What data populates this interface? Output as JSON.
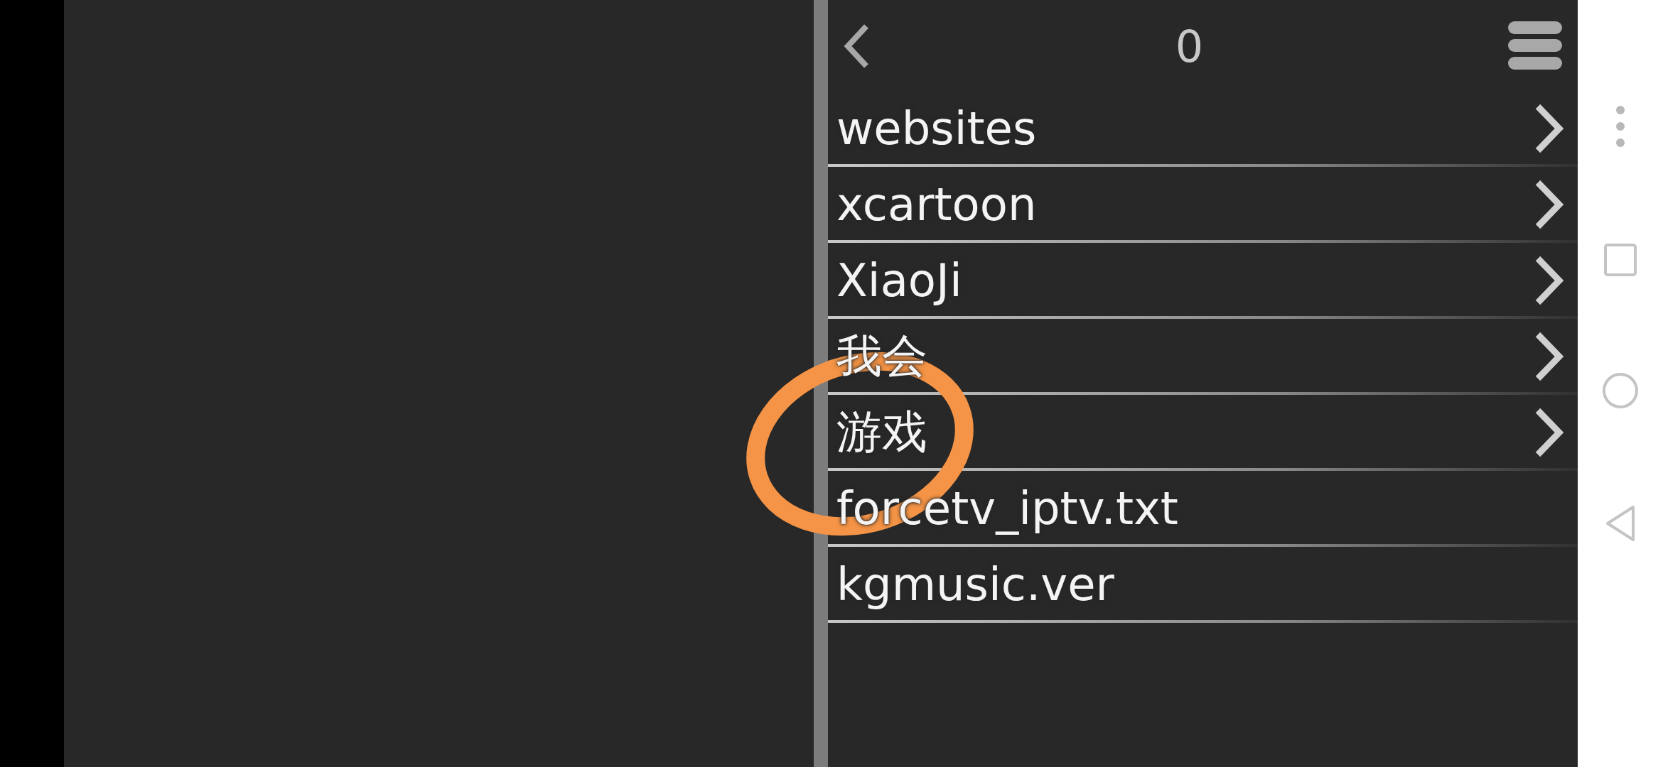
{
  "header": {
    "title": "0"
  },
  "items": [
    {
      "label": "websites",
      "kind": "folder"
    },
    {
      "label": "xcartoon",
      "kind": "folder"
    },
    {
      "label": "XiaoJi",
      "kind": "folder"
    },
    {
      "label": "我会",
      "kind": "folder"
    },
    {
      "label": "游戏",
      "kind": "folder"
    },
    {
      "label": "forcetv_iptv.txt",
      "kind": "file"
    },
    {
      "label": "kgmusic.ver",
      "kind": "file"
    }
  ]
}
